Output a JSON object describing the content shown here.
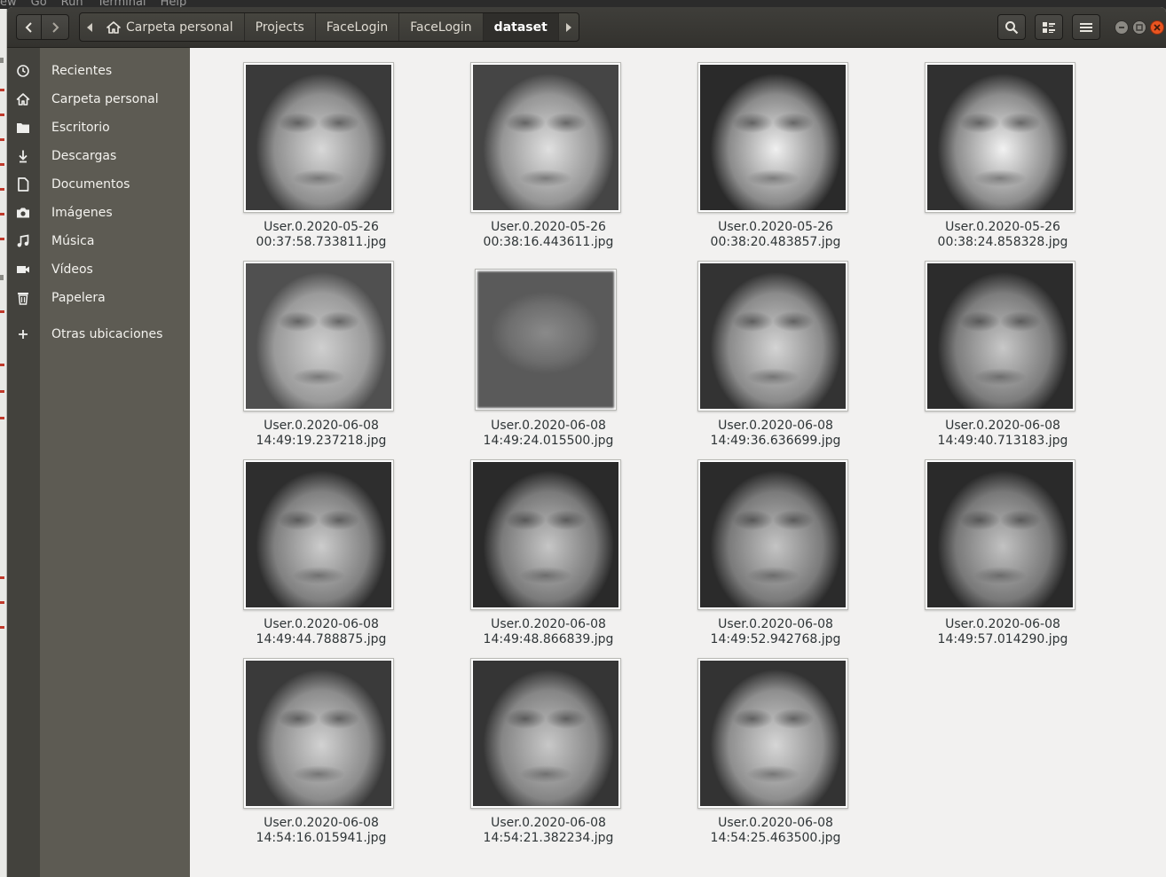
{
  "background_app": {
    "menu": [
      "ew",
      "Go",
      "Run",
      "Terminal",
      "Help"
    ]
  },
  "toolbar": {
    "back_icon": "chevron-left-icon",
    "forward_icon": "chevron-right-icon",
    "search_icon": "search-icon",
    "view_icon": "list-view-icon",
    "menu_icon": "hamburger-menu-icon"
  },
  "pathbar": {
    "crumbs": [
      "Carpeta personal",
      "Projects",
      "FaceLogin",
      "FaceLogin",
      "dataset"
    ]
  },
  "sidebar": {
    "items": [
      {
        "label": "Recientes",
        "icon": "clock-icon"
      },
      {
        "label": "Carpeta personal",
        "icon": "home-icon"
      },
      {
        "label": "Escritorio",
        "icon": "folder-icon"
      },
      {
        "label": "Descargas",
        "icon": "download-icon"
      },
      {
        "label": "Documentos",
        "icon": "document-icon"
      },
      {
        "label": "Imágenes",
        "icon": "camera-icon"
      },
      {
        "label": "Música",
        "icon": "music-icon"
      },
      {
        "label": "Vídeos",
        "icon": "video-icon"
      },
      {
        "label": "Papelera",
        "icon": "trash-icon"
      }
    ],
    "other": {
      "label": "Otras ubicaciones",
      "icon": "plus-icon"
    }
  },
  "files": [
    {
      "line1": "User.0.2020-05-26",
      "line2": "00:37:58.733811.jpg"
    },
    {
      "line1": "User.0.2020-05-26",
      "line2": "00:38:16.443611.jpg"
    },
    {
      "line1": "User.0.2020-05-26",
      "line2": "00:38:20.483857.jpg"
    },
    {
      "line1": "User.0.2020-05-26",
      "line2": "00:38:24.858328.jpg"
    },
    {
      "line1": "User.0.2020-06-08",
      "line2": "14:49:19.237218.jpg"
    },
    {
      "line1": "User.0.2020-06-08",
      "line2": "14:49:24.015500.jpg"
    },
    {
      "line1": "User.0.2020-06-08",
      "line2": "14:49:36.636699.jpg"
    },
    {
      "line1": "User.0.2020-06-08",
      "line2": "14:49:40.713183.jpg"
    },
    {
      "line1": "User.0.2020-06-08",
      "line2": "14:49:44.788875.jpg"
    },
    {
      "line1": "User.0.2020-06-08",
      "line2": "14:49:48.866839.jpg"
    },
    {
      "line1": "User.0.2020-06-08",
      "line2": "14:49:52.942768.jpg"
    },
    {
      "line1": "User.0.2020-06-08",
      "line2": "14:49:57.014290.jpg"
    },
    {
      "line1": "User.0.2020-06-08",
      "line2": "14:54:16.015941.jpg"
    },
    {
      "line1": "User.0.2020-06-08",
      "line2": "14:54:21.382234.jpg"
    },
    {
      "line1": "User.0.2020-06-08",
      "line2": "14:54:25.463500.jpg"
    }
  ],
  "colors": {
    "headerbar": "#3c3b37",
    "sidebar": "#5d5b53",
    "content": "#f2f1f0",
    "close": "#e95420"
  }
}
